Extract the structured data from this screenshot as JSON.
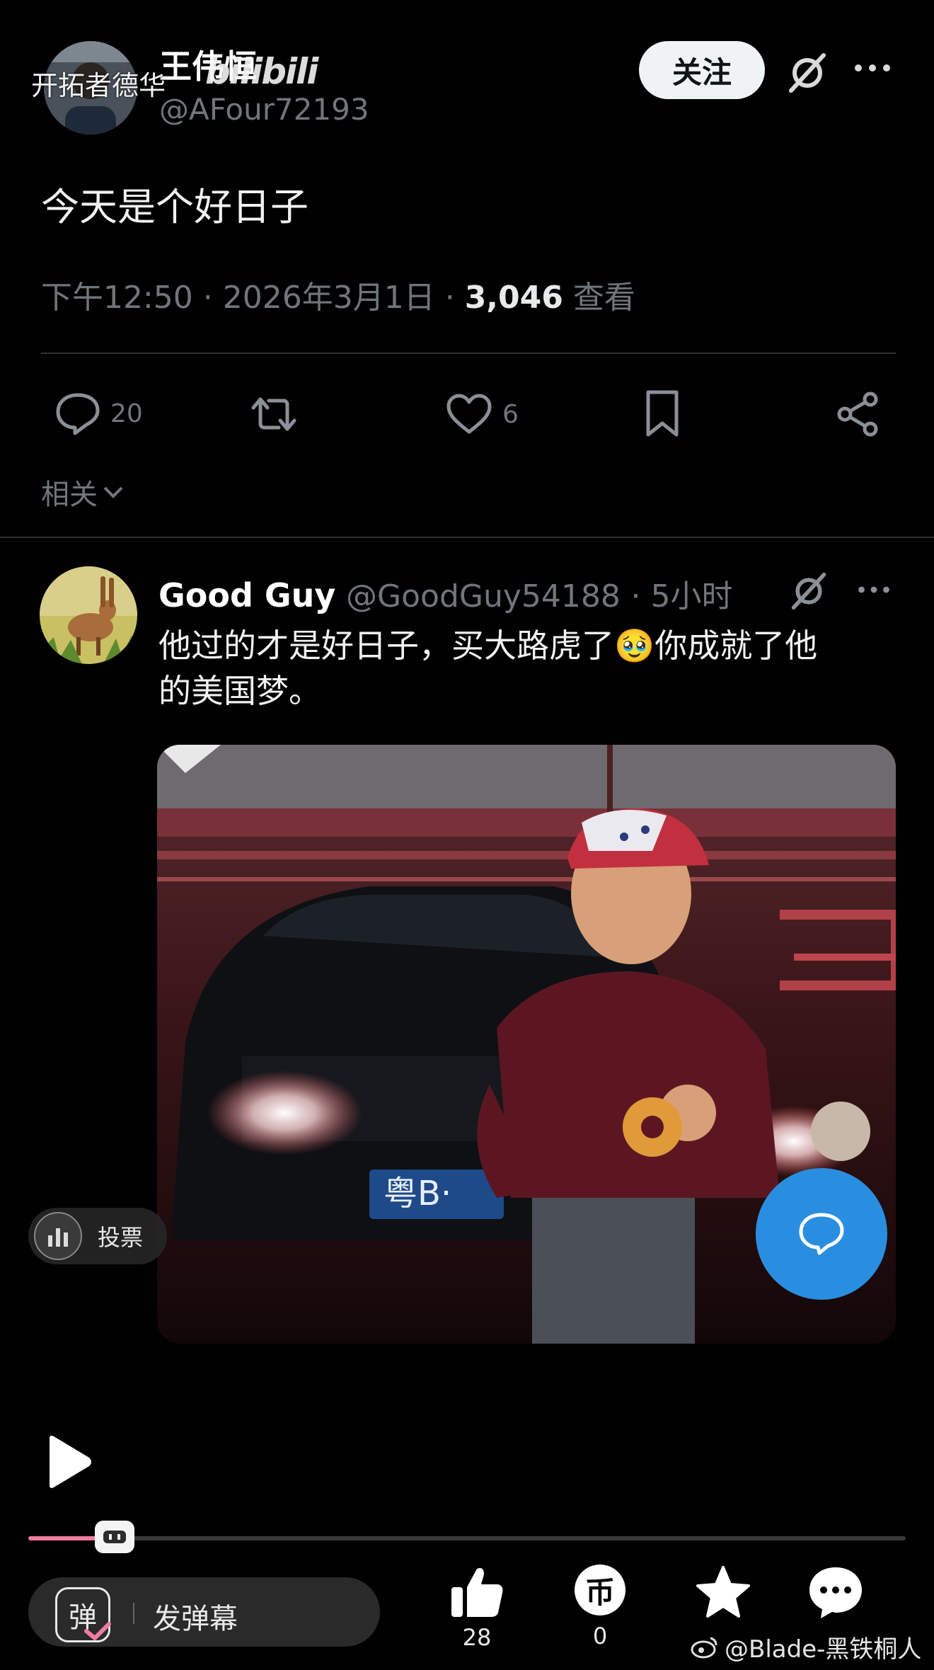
{
  "watermark": {
    "channel": "开拓者德华",
    "site_logo": "bilibili",
    "weibo_credit": "@Blade-黑铁桐人"
  },
  "post": {
    "author_name": "王伟恒",
    "handle": "@AFour72193",
    "follow_label": "关注",
    "text": "今天是个好日子",
    "time": "下午12:50 · 2026年3月1日 · ",
    "views_count": "3,046",
    "views_label": " 查看",
    "actions": {
      "reply_count": "20",
      "like_count": "6"
    },
    "related_label": "相关"
  },
  "reply": {
    "author_name": "Good Guy",
    "handle": "@GoodGuy54188",
    "time": "· 5小时",
    "text_part1": "他过的才是好日子，买大路虎了",
    "emoji": "🥹",
    "text_part2": "你成就了他",
    "text_line2": "的美国梦。",
    "media": {
      "plate_text": "粤B·"
    }
  },
  "overlay": {
    "poll_label": "投票"
  },
  "player": {
    "progress": 0.06,
    "danmaku_badge": "弹",
    "danmaku_label": "发弹幕",
    "like_count": "28",
    "coin_count": "0",
    "coin_glyph": "币",
    "star_count": ""
  }
}
